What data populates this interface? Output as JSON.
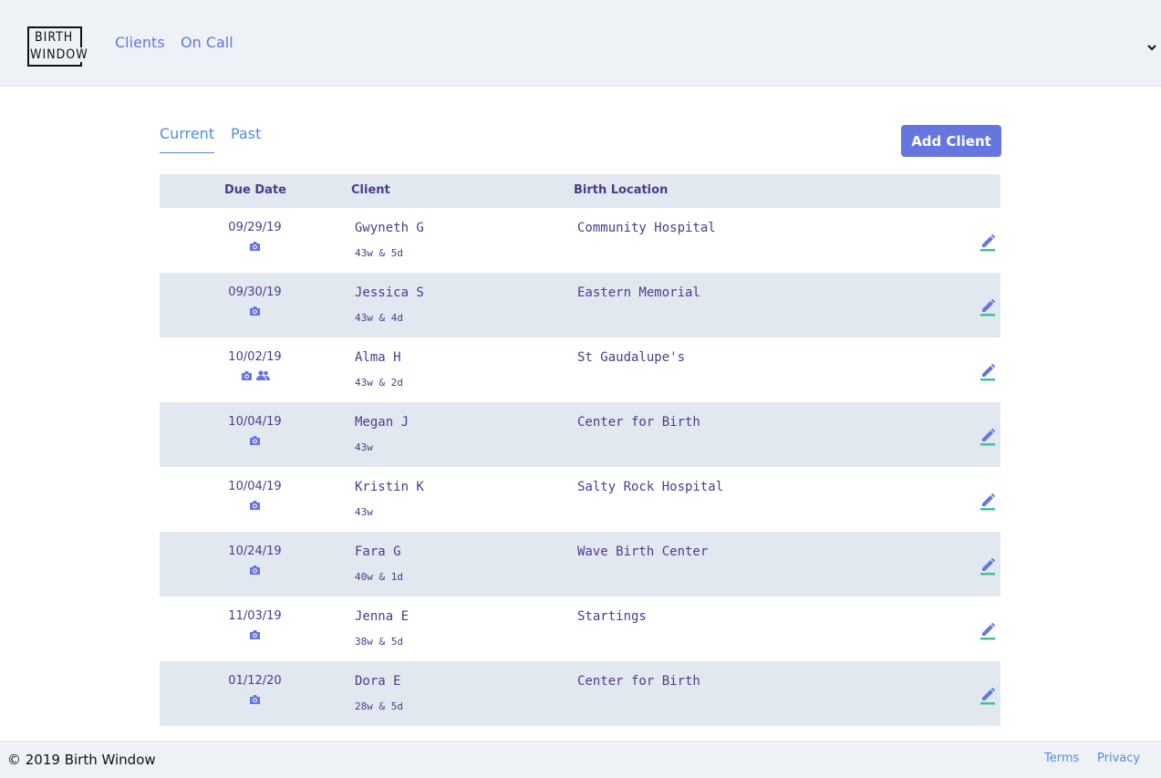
{
  "brand": {
    "logo_line1": "BIRTH",
    "logo_line2": "WINDOW"
  },
  "nav": {
    "clients": "Clients",
    "on_call": "On Call"
  },
  "tabs": {
    "current": "Current",
    "past": "Past"
  },
  "actions": {
    "add_client": "Add Client"
  },
  "table": {
    "headers": {
      "due_date": "Due Date",
      "client": "Client",
      "birth_location": "Birth Location"
    },
    "rows": [
      {
        "due_date": "09/29/19",
        "name": "Gwyneth G",
        "weeks": "43w & 5d",
        "location": "Community Hospital",
        "icons": [
          "camera-icon"
        ]
      },
      {
        "due_date": "09/30/19",
        "name": "Jessica S",
        "weeks": "43w & 4d",
        "location": "Eastern Memorial",
        "icons": [
          "camera-icon"
        ]
      },
      {
        "due_date": "10/02/19",
        "name": "Alma H",
        "weeks": "43w & 2d",
        "location": "St Gaudalupe's",
        "icons": [
          "camera-icon",
          "users-icon"
        ]
      },
      {
        "due_date": "10/04/19",
        "name": "Megan J",
        "weeks": "43w",
        "location": "Center for Birth",
        "icons": [
          "camera-icon"
        ]
      },
      {
        "due_date": "10/04/19",
        "name": "Kristin K",
        "weeks": "43w",
        "location": "Salty Rock Hospital",
        "icons": [
          "camera-icon"
        ]
      },
      {
        "due_date": "10/24/19",
        "name": "Fara G",
        "weeks": "40w & 1d",
        "location": "Wave Birth Center",
        "icons": [
          "camera-icon"
        ]
      },
      {
        "due_date": "11/03/19",
        "name": "Jenna E",
        "weeks": "38w & 5d",
        "location": "Startings",
        "icons": [
          "camera-icon"
        ]
      },
      {
        "due_date": "01/12/20",
        "name": "Dora E",
        "weeks": "28w & 5d",
        "location": "Center for Birth",
        "icons": [
          "camera-icon"
        ]
      }
    ]
  },
  "footer": {
    "copyright": "© 2019 Birth Window",
    "terms": "Terms",
    "privacy": "Privacy"
  },
  "colors": {
    "accent": "#6576e0",
    "link": "#4a90d9",
    "text": "#4c3b8f",
    "stripe": "#e2e8f0",
    "header_bg": "#eef2f6",
    "pencil_underline": "#3fbfa0"
  }
}
